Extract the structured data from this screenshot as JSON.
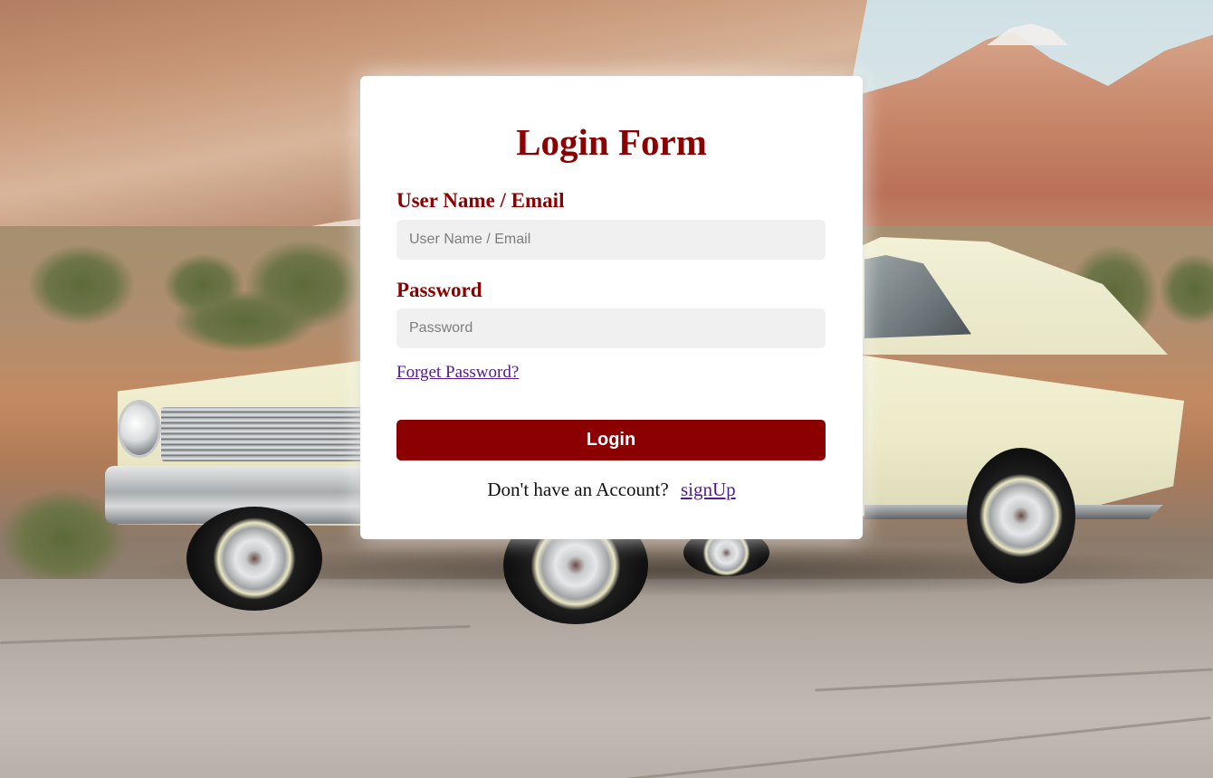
{
  "login_form": {
    "title": "Login Form",
    "username": {
      "label": "User Name / Email",
      "placeholder": "User Name / Email",
      "value": ""
    },
    "password": {
      "label": "Password",
      "placeholder": "Password",
      "value": ""
    },
    "forgot_password_link": "Forget Password?",
    "submit_label": "Login",
    "signup_prompt": "Don't have an Account?",
    "signup_link": "signUp"
  },
  "colors": {
    "accent": "#8b0000",
    "link": "#551a8b",
    "card_background": "#ffffff",
    "input_background": "#f0f0f0"
  }
}
